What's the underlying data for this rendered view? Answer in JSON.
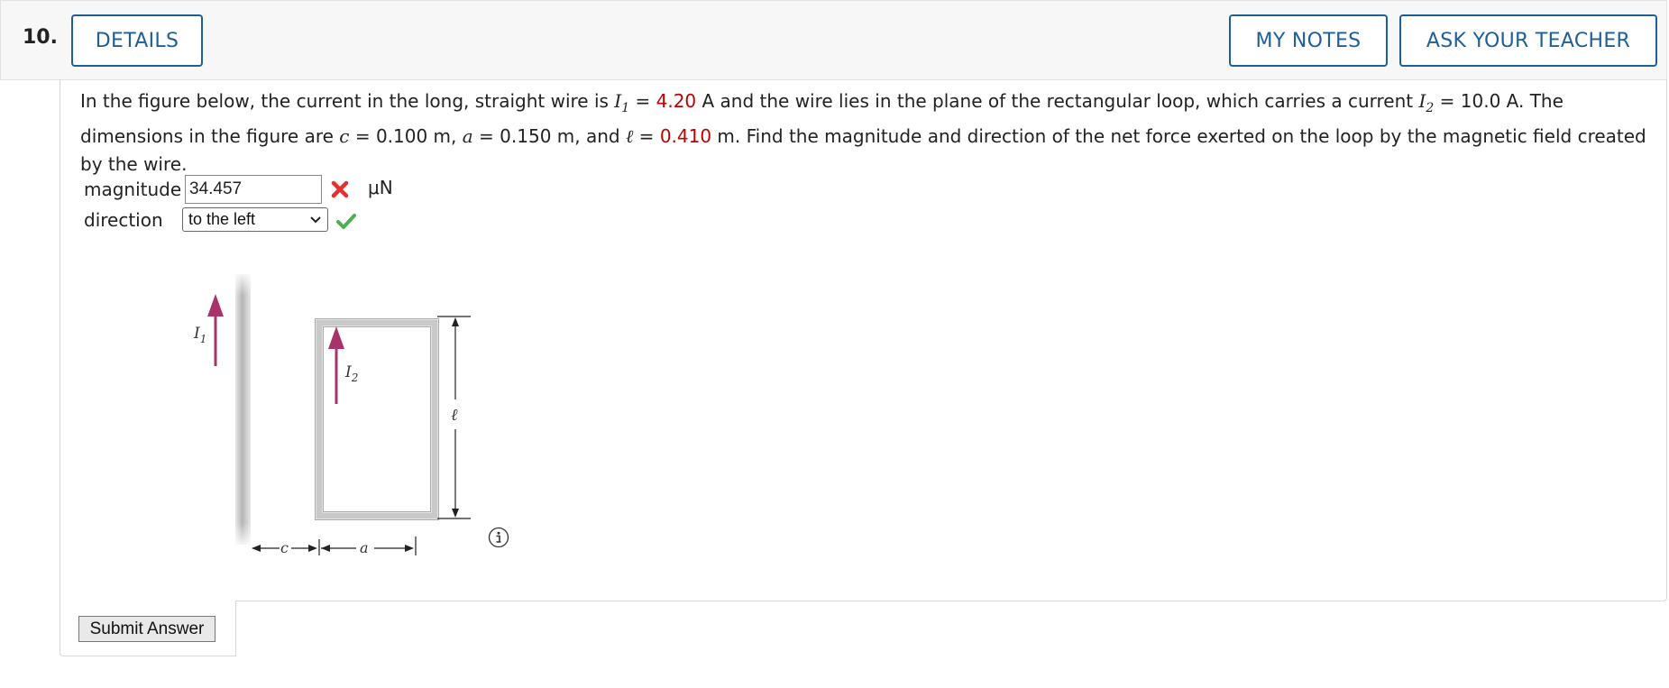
{
  "question": {
    "number": "10.",
    "details_label": "DETAILS",
    "my_notes_label": "MY NOTES",
    "ask_teacher_label": "ASK YOUR TEACHER"
  },
  "problem": {
    "t1": "In the figure below, the current in the long, straight wire is ",
    "I1_symbol": "I",
    "I1_sub": "1",
    "eq1": " = ",
    "I1_value": "4.20",
    "t2": " A and the wire lies in the plane of the rectangular loop, which carries a current ",
    "I2_symbol": "I",
    "I2_sub": "2",
    "t3": " = 10.0 A. The dimensions in the figure are ",
    "c_symbol": "c",
    "t4": " = 0.100 m, ",
    "a_symbol": "a",
    "t5": " = 0.150 m, and ",
    "l_symbol": "ℓ",
    "t6": " = ",
    "l_value": "0.410",
    "t7": " m. Find the magnitude and direction of the net force exerted on the loop by the magnetic field created by the wire."
  },
  "answers": {
    "magnitude_label": "magnitude",
    "magnitude_value": "34.457",
    "magnitude_status": "incorrect",
    "unit": "μN",
    "direction_label": "direction",
    "direction_value": "to the left",
    "direction_status": "correct"
  },
  "figure": {
    "I1_label": "I",
    "I1_sub": "1",
    "I2_label": "I",
    "I2_sub": "2",
    "l_label": "ℓ",
    "c_label": "c",
    "a_label": "a"
  },
  "colors": {
    "accent": "#1e5f99",
    "given_value": "#c00000",
    "arrow": "#a8336b",
    "incorrect": "#e53030",
    "correct": "#4caf50"
  },
  "icons": {
    "incorrect": "x-mark-icon",
    "correct": "checkmark-icon",
    "info": "info-icon",
    "dropdown": "chevron-down-icon"
  },
  "submit_label": "Submit Answer"
}
